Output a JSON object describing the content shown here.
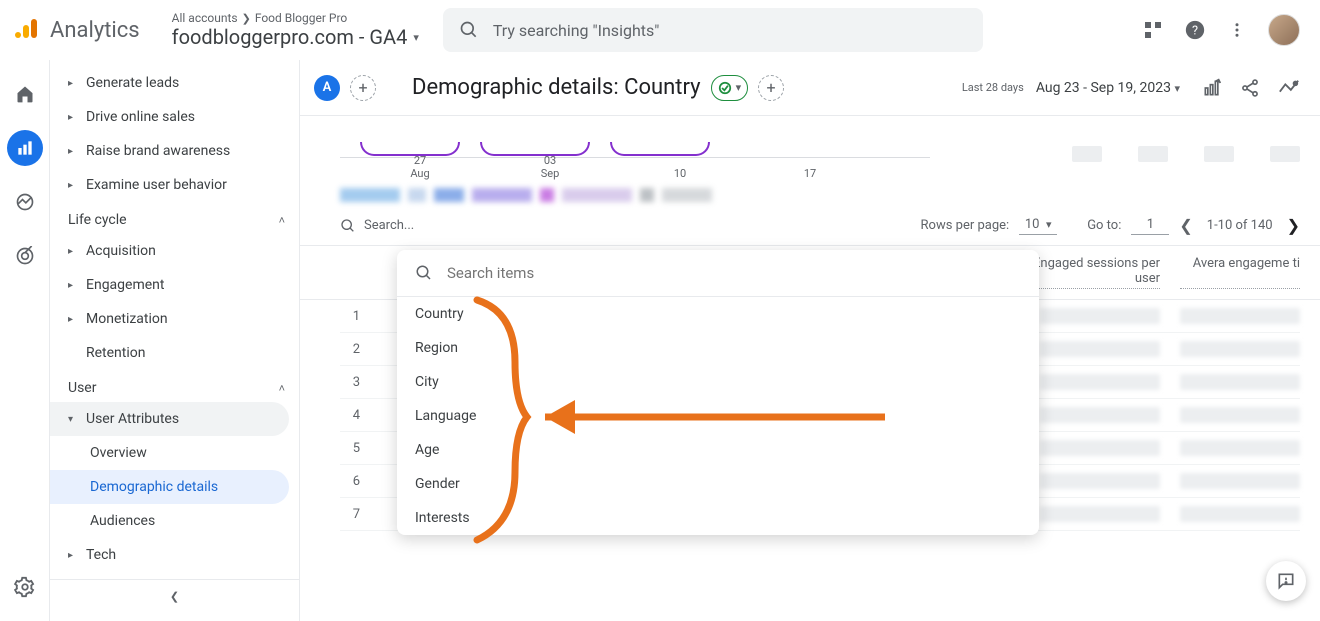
{
  "brand": "Analytics",
  "breadcrumb": {
    "all": "All accounts",
    "account": "Food Blogger Pro"
  },
  "property": "foodbloggerpro.com - GA4",
  "search_placeholder": "Try searching \"Insights\"",
  "sidebar": {
    "topics": [
      "Generate leads",
      "Drive online sales",
      "Raise brand awareness",
      "Examine user behavior"
    ],
    "lifecycle_label": "Life cycle",
    "lifecycle": [
      "Acquisition",
      "Engagement",
      "Monetization",
      "Retention"
    ],
    "user_label": "User",
    "user_attributes_label": "User Attributes",
    "user_attributes": [
      "Overview",
      "Demographic details",
      "Audiences"
    ],
    "user_attributes_active_index": 1,
    "tech_label": "Tech"
  },
  "report": {
    "badge": "A",
    "title": "Demographic details: Country",
    "date_label": "Last 28 days",
    "date_range": "Aug 23 - Sep 19, 2023"
  },
  "chart_xlabels": [
    {
      "d": "27",
      "m": "Aug"
    },
    {
      "d": "03",
      "m": "Sep"
    },
    {
      "d": "10",
      "m": ""
    },
    {
      "d": "17",
      "m": ""
    }
  ],
  "table": {
    "search_placeholder": "Search...",
    "rows_per_page_label": "Rows per page:",
    "rows_per_page_value": "10",
    "goto_label": "Go to:",
    "goto_value": "1",
    "range": "1-10 of 140",
    "metric1": "Engaged sessions per user",
    "metric2": "Avera engageme ti",
    "rows": [
      1,
      2,
      3,
      4,
      5,
      6,
      7
    ]
  },
  "popup": {
    "search_placeholder": "Search items",
    "items": [
      "Country",
      "Region",
      "City",
      "Language",
      "Age",
      "Gender",
      "Interests"
    ]
  }
}
